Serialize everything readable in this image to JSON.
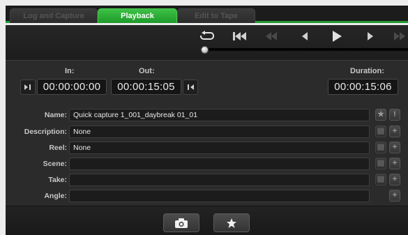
{
  "tabs": [
    {
      "label": "Log and Capture",
      "active": false
    },
    {
      "label": "Playback",
      "active": true
    },
    {
      "label": "Edit to Tape",
      "active": false
    }
  ],
  "transport": {
    "buttons": [
      "loop-icon",
      "skip-to-start-icon",
      "rewind-icon",
      "step-back-icon",
      "play-icon",
      "step-forward-icon",
      "fast-forward-icon"
    ]
  },
  "timecode": {
    "in_label": "In:",
    "in_value": "00:00:00:00",
    "out_label": "Out:",
    "out_value": "00:00:15:05",
    "duration_label": "Duration:",
    "duration_value": "00:00:15:06"
  },
  "metadata": {
    "name_label": "Name:",
    "name_value": "Quick capture 1_001_daybreak 01_01",
    "description_label": "Description:",
    "description_value": "None",
    "reel_label": "Reel:",
    "reel_value": "None",
    "scene_label": "Scene:",
    "scene_value": "",
    "take_label": "Take:",
    "take_value": "",
    "angle_label": "Angle:",
    "angle_value": ""
  },
  "colors": {
    "accent_green": "#1f9a2e",
    "panel_bg": "#2b2b2b",
    "field_bg": "#1c1c1c"
  },
  "bottom": {
    "buttons": [
      "camera-icon",
      "star-icon"
    ]
  }
}
